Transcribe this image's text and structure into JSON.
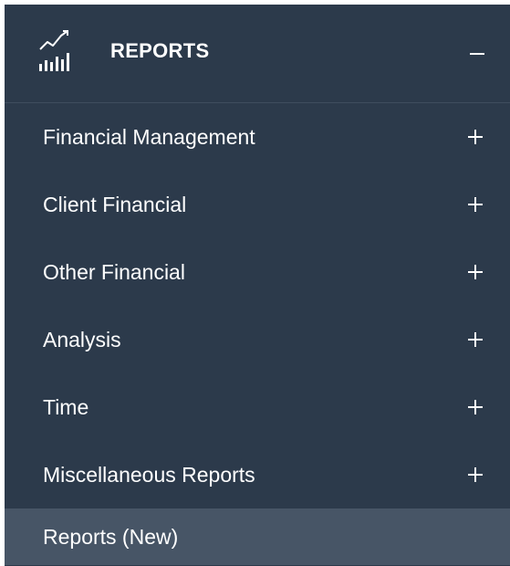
{
  "section": {
    "title": "REPORTS",
    "icon": "reports-chart-icon",
    "collapse_icon": "minus-icon"
  },
  "menu": {
    "items": [
      {
        "label": "Financial Management",
        "expand_icon": "plus-icon"
      },
      {
        "label": "Client Financial",
        "expand_icon": "plus-icon"
      },
      {
        "label": "Other Financial",
        "expand_icon": "plus-icon"
      },
      {
        "label": "Analysis",
        "expand_icon": "plus-icon"
      },
      {
        "label": "Time",
        "expand_icon": "plus-icon"
      },
      {
        "label": "Miscellaneous Reports",
        "expand_icon": "plus-icon"
      },
      {
        "label": "Reports (New)",
        "active": true
      }
    ]
  },
  "colors": {
    "panel_bg": "#2c3a4b",
    "active_bg": "#475566",
    "text": "#ffffff"
  }
}
